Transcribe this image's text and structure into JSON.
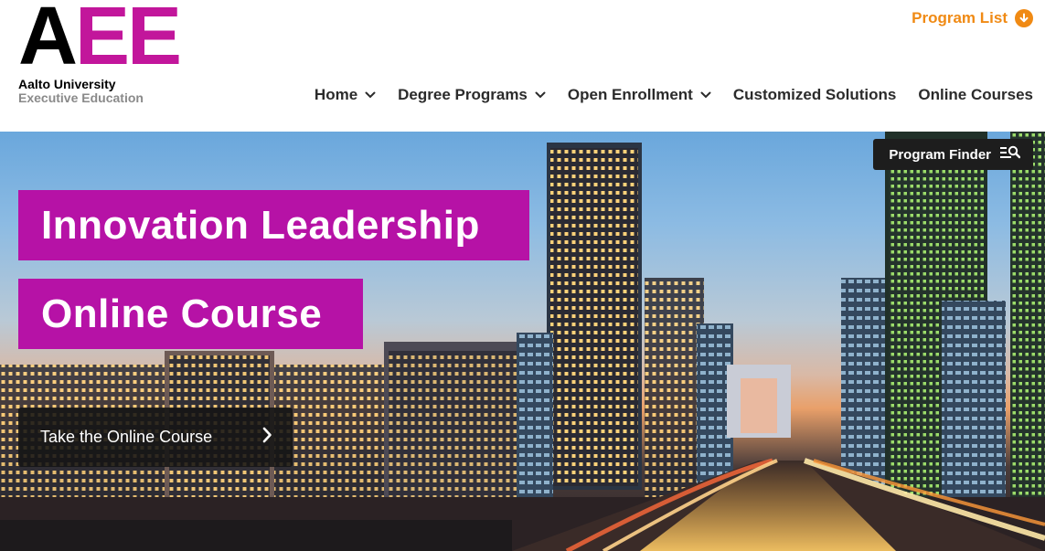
{
  "logo": {
    "letter_1": "A",
    "letter_2": "E",
    "letter_3": "E",
    "line_1": "Aalto University",
    "line_2": "Executive Education"
  },
  "header": {
    "program_list_label": "Program List"
  },
  "nav": {
    "items": [
      {
        "label": "Home",
        "has_dropdown": true
      },
      {
        "label": "Degree Programs",
        "has_dropdown": true
      },
      {
        "label": "Open Enrollment",
        "has_dropdown": true
      },
      {
        "label": "Customized Solutions",
        "has_dropdown": false
      },
      {
        "label": "Online Courses",
        "has_dropdown": false
      }
    ]
  },
  "hero": {
    "program_finder_label": "Program Finder",
    "title_line_1": "Innovation Leadership",
    "title_line_2": "Online Course",
    "cta_label": "Take the Online Course"
  },
  "colors": {
    "brand_magenta": "#b612a6",
    "accent_orange": "#f08a14",
    "nav_text": "#2b2b2b"
  },
  "icons": {
    "program_list": "download-circle-icon",
    "nav_dropdown": "chevron-down-icon",
    "program_finder": "list-search-icon",
    "cta": "chevron-right-icon"
  }
}
